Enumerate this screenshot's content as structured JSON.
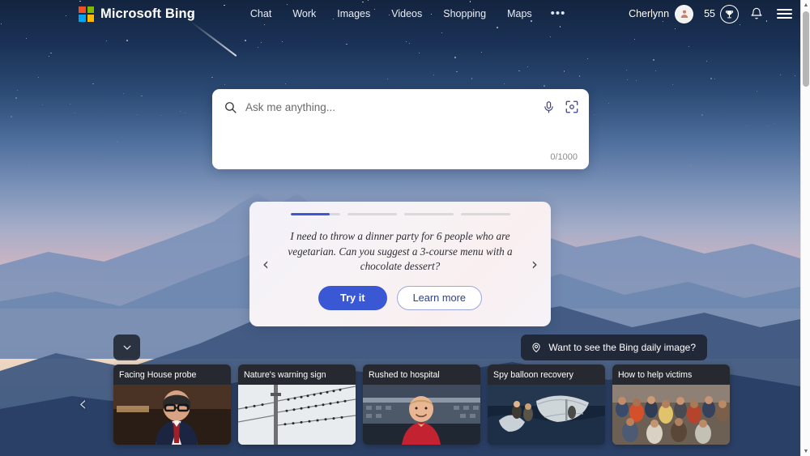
{
  "header": {
    "brand": "Microsoft Bing",
    "logo_icon": "microsoft-squares-icon",
    "logo_colors": [
      "#f25022",
      "#7fba00",
      "#00a4ef",
      "#ffb900"
    ],
    "nav": [
      {
        "label": "Chat"
      },
      {
        "label": "Work"
      },
      {
        "label": "Images"
      },
      {
        "label": "Videos"
      },
      {
        "label": "Shopping"
      },
      {
        "label": "Maps"
      }
    ],
    "more_label": "•••",
    "user_name": "Cherlynn",
    "avatar_icon": "person-avatar-icon",
    "rewards_count": "55",
    "rewards_icon": "trophy-icon",
    "notifications_icon": "bell-icon",
    "menu_icon": "hamburger-menu-icon"
  },
  "search": {
    "value": "",
    "placeholder": "Ask me anything...",
    "search_icon": "search-icon",
    "mic_icon": "microphone-icon",
    "lens_icon": "visual-search-camera-icon",
    "char_count": "0/1000"
  },
  "promo": {
    "prev_icon": "‹",
    "next_icon": "›",
    "text": "I need to throw a dinner party for 6 people who are vegetarian. Can you suggest a 3-course menu with a chocolate dessert?",
    "try_label": "Try it",
    "learn_label": "Learn more",
    "accent_color": "#3b58d4",
    "segments": [
      {
        "progress": 80,
        "active": true
      },
      {
        "progress": 0,
        "active": false
      },
      {
        "progress": 0,
        "active": false
      },
      {
        "progress": 0,
        "active": false
      }
    ]
  },
  "daily_image": {
    "label": "Want to see the Bing daily image?",
    "icon": "location-pin-icon"
  },
  "collapse": {
    "icon": "chevron-down-icon"
  },
  "carousel": {
    "prev_icon": "‹",
    "next_icon": "›",
    "cards": [
      {
        "title": "Facing House probe",
        "image": "man-in-suit-with-glasses-at-hearing"
      },
      {
        "title": "Nature's warning sign",
        "image": "birds-on-power-lines"
      },
      {
        "title": "Rushed to hospital",
        "image": "man-in-red-shirt-at-stadium"
      },
      {
        "title": "Spy balloon recovery",
        "image": "sailors-recovering-balloon-debris"
      },
      {
        "title": "How to help victims",
        "image": "crowd-of-people-receiving-aid"
      }
    ]
  },
  "scrollbar": {
    "up_icon": "▲",
    "down_icon": "▼"
  }
}
